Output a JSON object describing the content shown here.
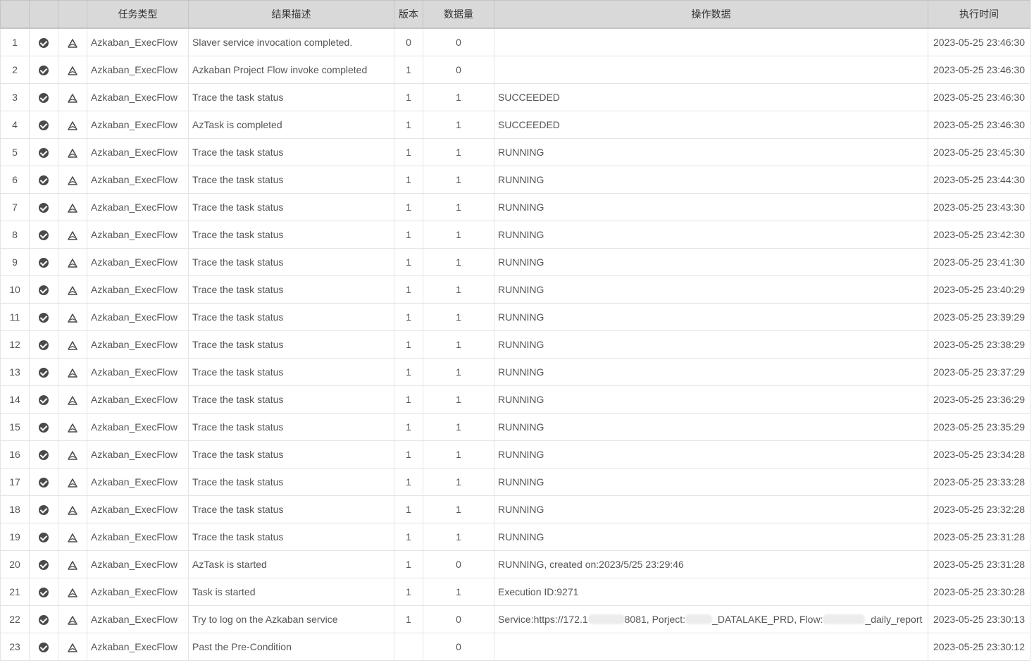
{
  "table": {
    "headers": [
      "",
      "",
      "",
      "任务类型",
      "结果描述",
      "版本",
      "数据量",
      "操作数据",
      "执行时间"
    ],
    "rows": [
      {
        "idx": "1",
        "type": "Azkaban_ExecFlow",
        "desc": "Slaver service invocation completed.",
        "ver": "0",
        "cnt": "0",
        "data": "",
        "time": "2023-05-25 23:46:30"
      },
      {
        "idx": "2",
        "type": "Azkaban_ExecFlow",
        "desc": "Azkaban Project Flow invoke completed",
        "ver": "1",
        "cnt": "0",
        "data": "",
        "time": "2023-05-25 23:46:30"
      },
      {
        "idx": "3",
        "type": "Azkaban_ExecFlow",
        "desc": "Trace the task status",
        "ver": "1",
        "cnt": "1",
        "data": "SUCCEEDED",
        "time": "2023-05-25 23:46:30"
      },
      {
        "idx": "4",
        "type": "Azkaban_ExecFlow",
        "desc": "AzTask is completed",
        "ver": "1",
        "cnt": "1",
        "data": "SUCCEEDED",
        "time": "2023-05-25 23:46:30"
      },
      {
        "idx": "5",
        "type": "Azkaban_ExecFlow",
        "desc": "Trace the task status",
        "ver": "1",
        "cnt": "1",
        "data": "RUNNING",
        "time": "2023-05-25 23:45:30"
      },
      {
        "idx": "6",
        "type": "Azkaban_ExecFlow",
        "desc": "Trace the task status",
        "ver": "1",
        "cnt": "1",
        "data": "RUNNING",
        "time": "2023-05-25 23:44:30"
      },
      {
        "idx": "7",
        "type": "Azkaban_ExecFlow",
        "desc": "Trace the task status",
        "ver": "1",
        "cnt": "1",
        "data": "RUNNING",
        "time": "2023-05-25 23:43:30"
      },
      {
        "idx": "8",
        "type": "Azkaban_ExecFlow",
        "desc": "Trace the task status",
        "ver": "1",
        "cnt": "1",
        "data": "RUNNING",
        "time": "2023-05-25 23:42:30"
      },
      {
        "idx": "9",
        "type": "Azkaban_ExecFlow",
        "desc": "Trace the task status",
        "ver": "1",
        "cnt": "1",
        "data": "RUNNING",
        "time": "2023-05-25 23:41:30"
      },
      {
        "idx": "10",
        "type": "Azkaban_ExecFlow",
        "desc": "Trace the task status",
        "ver": "1",
        "cnt": "1",
        "data": "RUNNING",
        "time": "2023-05-25 23:40:29"
      },
      {
        "idx": "11",
        "type": "Azkaban_ExecFlow",
        "desc": "Trace the task status",
        "ver": "1",
        "cnt": "1",
        "data": "RUNNING",
        "time": "2023-05-25 23:39:29"
      },
      {
        "idx": "12",
        "type": "Azkaban_ExecFlow",
        "desc": "Trace the task status",
        "ver": "1",
        "cnt": "1",
        "data": "RUNNING",
        "time": "2023-05-25 23:38:29"
      },
      {
        "idx": "13",
        "type": "Azkaban_ExecFlow",
        "desc": "Trace the task status",
        "ver": "1",
        "cnt": "1",
        "data": "RUNNING",
        "time": "2023-05-25 23:37:29"
      },
      {
        "idx": "14",
        "type": "Azkaban_ExecFlow",
        "desc": "Trace the task status",
        "ver": "1",
        "cnt": "1",
        "data": "RUNNING",
        "time": "2023-05-25 23:36:29"
      },
      {
        "idx": "15",
        "type": "Azkaban_ExecFlow",
        "desc": "Trace the task status",
        "ver": "1",
        "cnt": "1",
        "data": "RUNNING",
        "time": "2023-05-25 23:35:29"
      },
      {
        "idx": "16",
        "type": "Azkaban_ExecFlow",
        "desc": "Trace the task status",
        "ver": "1",
        "cnt": "1",
        "data": "RUNNING",
        "time": "2023-05-25 23:34:28"
      },
      {
        "idx": "17",
        "type": "Azkaban_ExecFlow",
        "desc": "Trace the task status",
        "ver": "1",
        "cnt": "1",
        "data": "RUNNING",
        "time": "2023-05-25 23:33:28"
      },
      {
        "idx": "18",
        "type": "Azkaban_ExecFlow",
        "desc": "Trace the task status",
        "ver": "1",
        "cnt": "1",
        "data": "RUNNING",
        "time": "2023-05-25 23:32:28"
      },
      {
        "idx": "19",
        "type": "Azkaban_ExecFlow",
        "desc": "Trace the task status",
        "ver": "1",
        "cnt": "1",
        "data": "RUNNING",
        "time": "2023-05-25 23:31:28"
      },
      {
        "idx": "20",
        "type": "Azkaban_ExecFlow",
        "desc": "AzTask is started",
        "ver": "1",
        "cnt": "0",
        "data": "RUNNING, created on:2023/5/25 23:29:46",
        "time": "2023-05-25 23:31:28"
      },
      {
        "idx": "21",
        "type": "Azkaban_ExecFlow",
        "desc": "Task is started",
        "ver": "1",
        "cnt": "1",
        "data": "Execution ID:9271",
        "time": "2023-05-25 23:30:28"
      },
      {
        "idx": "22",
        "type": "Azkaban_ExecFlow",
        "desc": "Try to log on the Azkaban service",
        "ver": "1",
        "cnt": "0",
        "data": "",
        "data_parts": [
          "Service:https://172.1",
          "8081, Porject:",
          "_DATALAKE_PRD, Flow:",
          "_daily_report"
        ],
        "time": "2023-05-25 23:30:13"
      },
      {
        "idx": "23",
        "type": "Azkaban_ExecFlow",
        "desc": "Past the Pre-Condition",
        "ver": "",
        "cnt": "0",
        "data": "",
        "time": "2023-05-25 23:30:12"
      }
    ]
  },
  "icons": {
    "status": "check-circle-icon",
    "type": "azkaban-flow-icon"
  },
  "colors": {
    "header_bg": "#d9d9d9",
    "status_icon": "#4a4a4a",
    "text": "#555555"
  }
}
